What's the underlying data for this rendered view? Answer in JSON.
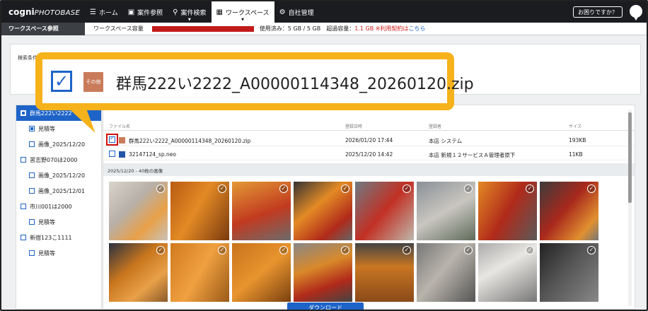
{
  "nav": {
    "logo_main": "cogni",
    "logo_sub": "PHOTOBASE",
    "items": [
      {
        "label": "ホーム",
        "icon": "menu-icon"
      },
      {
        "label": "案件参照",
        "icon": "photo-icon"
      },
      {
        "label": "案件検索",
        "icon": "search-icon"
      },
      {
        "label": "ワークスペース",
        "icon": "workspace-icon"
      },
      {
        "label": "自社管理",
        "icon": "gear-icon"
      }
    ],
    "help": "お困りですか？"
  },
  "subbar": {
    "title": "ワークスペース参照",
    "capacity_label": "ワークスペース容量",
    "used": "使用済み：5 GB / 5 GB",
    "over_label": "超過容量：",
    "over_value": "1.1 GB ※利用契約は",
    "link": "こちら"
  },
  "search": {
    "label": "検索条件"
  },
  "tree": [
    {
      "label": "群馬222い2222",
      "level": 0,
      "selected": true,
      "checked": true
    },
    {
      "label": "見積等",
      "level": 1,
      "checked": true
    },
    {
      "label": "画像_2025/12/20",
      "level": 1
    },
    {
      "label": "習志野070ほ2000",
      "level": 0
    },
    {
      "label": "画像_2025/12/20",
      "level": 1
    },
    {
      "label": "画像_2025/12/01",
      "level": 1
    },
    {
      "label": "市川001は2000",
      "level": 0
    },
    {
      "label": "見積等",
      "level": 1
    },
    {
      "label": "新宿123こ1111",
      "level": 0
    },
    {
      "label": "見積等",
      "level": 1
    }
  ],
  "files": {
    "headers": {
      "name": "ファイル名",
      "date": "登録日時",
      "user": "登録者",
      "size": "サイズ"
    },
    "rows": [
      {
        "name": "群馬222い2222_A00000114348_20260120.zip",
        "date": "2026/01/20 17:44",
        "user": "本店 システム",
        "size": "193KB",
        "checked": true,
        "type": "zip"
      },
      {
        "name": "32147124_sp.neo",
        "date": "2025/12/20 14:42",
        "user": "本店 新規１２サービスＡ管理者原下",
        "size": "11KB",
        "checked": false,
        "type": "neo"
      }
    ],
    "date_sep": "2025/12/20 - 40枚の画像"
  },
  "download": "ダウンロード",
  "callout": {
    "filename": "群馬222い2222_A00000114348_20260120.zip",
    "icon_text": "その他"
  },
  "colors": {
    "accent": "#1e64c8",
    "callout": "#f6b21b",
    "alert": "#d01a1a",
    "nav_bg": "#1b1c20"
  }
}
